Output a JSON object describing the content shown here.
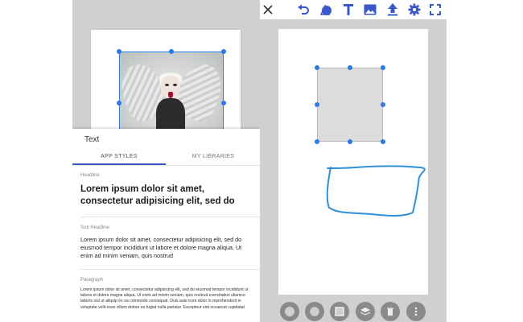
{
  "left": {
    "panel_title": "Text",
    "tabs": [
      {
        "label": "APP STYLES",
        "active": true
      },
      {
        "label": "MY LIBRARIES",
        "active": false
      }
    ],
    "styles": {
      "headline_label": "Headline",
      "headline_text": "Lorem ipsum dolor sit amet, consectetur adipisicing elit, sed do",
      "subheadline_label": "Sub Headline",
      "subheadline_text": "Lorem ipsum dolor sit amet, consectetur adipisicing elit, sed do eiusmod tempor incididunt ut labore et dolore magna aliqua. Ut enim ad minim veniam, quis nostrud",
      "paragraph_label": "Paragraph",
      "paragraph_text": "Lorem ipsum dolor sit amet, consectetur adipisicing elit, sed do eiusmod tempor incididunt ut labore et dolore magna aliqua. Ut enim ad minim veniam, quis nostrud exercitation ullamco laboris nisi ut aliquip ex ea commodo consequat. Duis aute irure dolor in reprehenderit in voluptate velit esse cillum dolore eu fugiat nulla pariatur. Excepteur sint occaecat cupidatat"
    }
  },
  "right": {
    "toolbar_icons": [
      "close-icon",
      "undo-icon",
      "shapes-icon",
      "text-icon",
      "image-icon",
      "upload-icon",
      "settings-icon",
      "fullscreen-icon"
    ],
    "bottom_icons": [
      "fill-circle-icon",
      "pattern-icon",
      "border-icon",
      "layers-icon",
      "delete-icon",
      "more-icon"
    ]
  },
  "colors": {
    "selection": "#2d7be0",
    "toolbar_icon": "#3a58c9",
    "tab_underline": "#3a58c9",
    "sketch": "#2f8fd8"
  }
}
